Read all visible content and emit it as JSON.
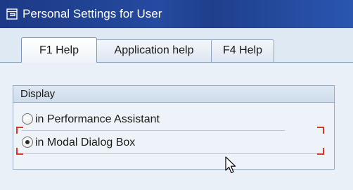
{
  "window": {
    "title": "Personal Settings for User"
  },
  "tabs": [
    {
      "label": "F1 Help",
      "active": true
    },
    {
      "label": "Application help",
      "active": false
    },
    {
      "label": "F4 Help",
      "active": false
    }
  ],
  "display_group": {
    "header": "Display",
    "options": [
      {
        "label": "in Performance Assistant",
        "selected": false
      },
      {
        "label": "in Modal Dialog Box",
        "selected": true
      }
    ]
  },
  "colors": {
    "title_bar": "#254aa0",
    "focus_marker": "#d43a2a",
    "panel_background": "#eaf0f7"
  },
  "icons": {
    "title": "settings-window-icon",
    "cursor": "mouse-pointer-icon"
  }
}
